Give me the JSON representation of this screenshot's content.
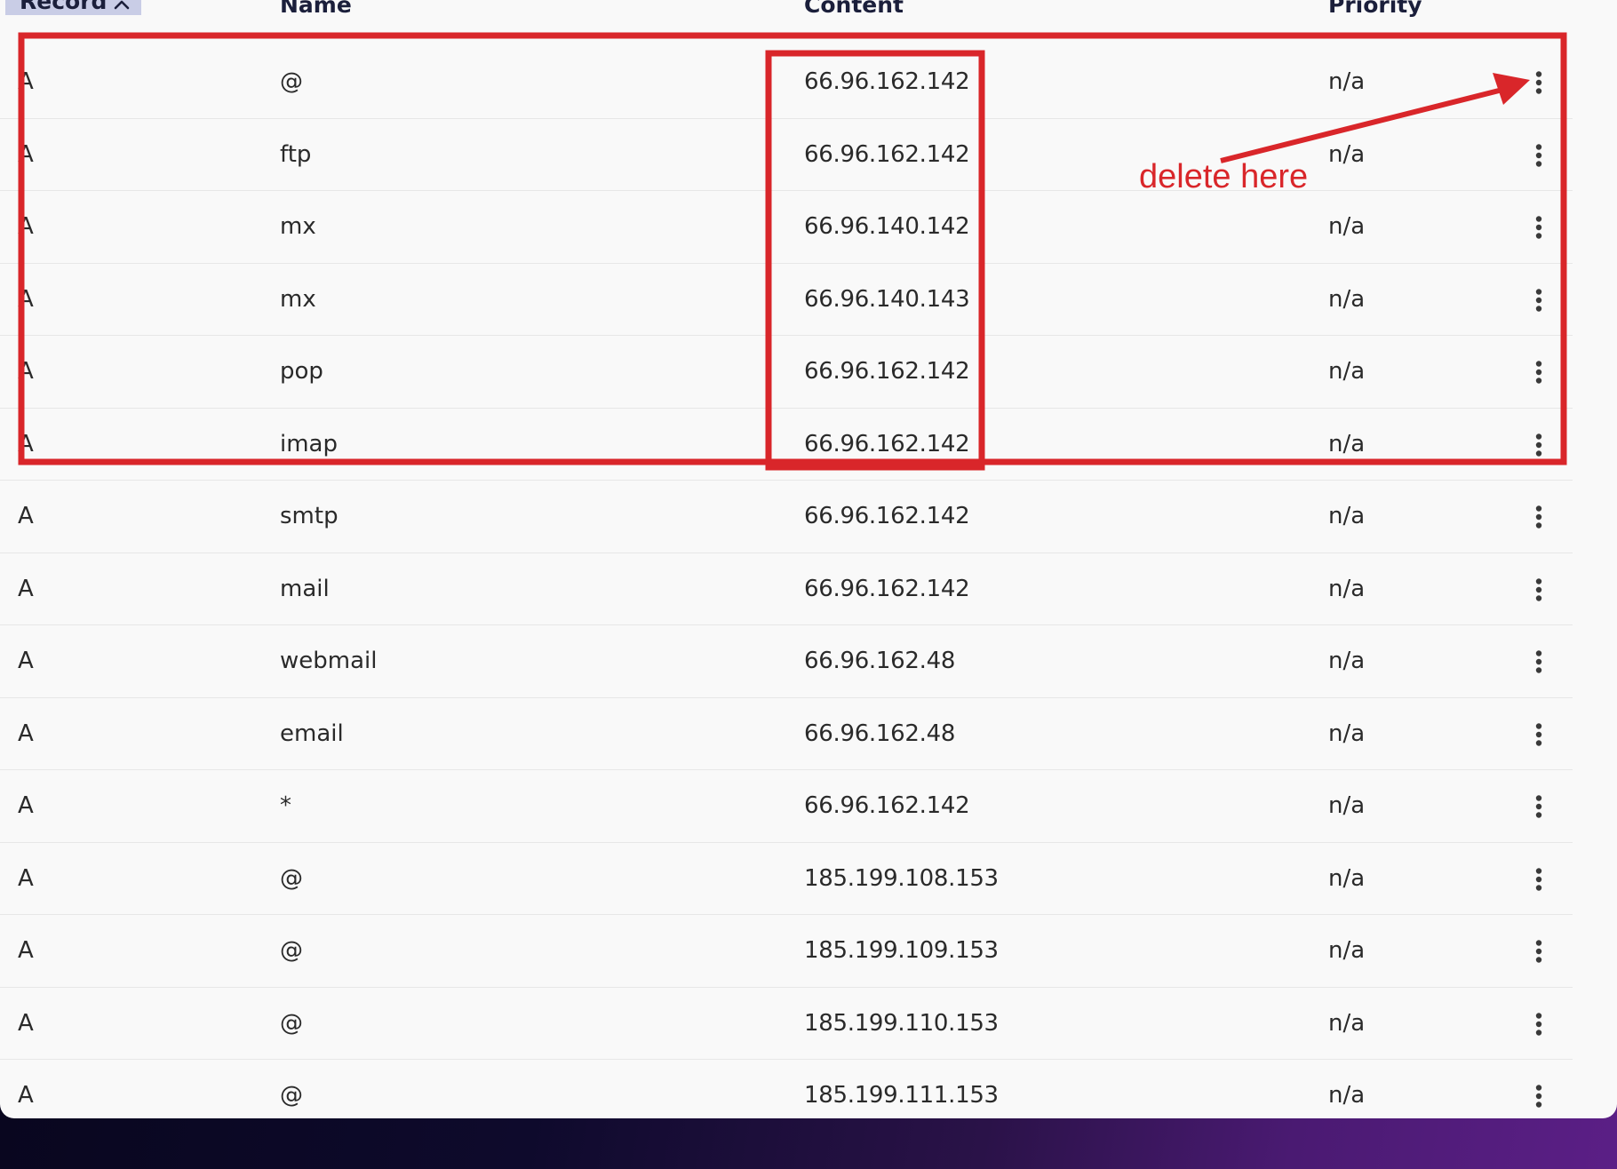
{
  "table": {
    "headers": {
      "record": "Record",
      "name": "Name",
      "content": "Content",
      "priority": "Priority"
    },
    "sort": {
      "column": "record",
      "direction": "ascending",
      "icon": "chevron-up-icon"
    },
    "rows": [
      {
        "record": "A",
        "name": "@",
        "content": "66.96.162.142",
        "priority": "n/a"
      },
      {
        "record": "A",
        "name": "ftp",
        "content": "66.96.162.142",
        "priority": "n/a"
      },
      {
        "record": "A",
        "name": "mx",
        "content": "66.96.140.142",
        "priority": "n/a"
      },
      {
        "record": "A",
        "name": "mx",
        "content": "66.96.140.143",
        "priority": "n/a"
      },
      {
        "record": "A",
        "name": "pop",
        "content": "66.96.162.142",
        "priority": "n/a"
      },
      {
        "record": "A",
        "name": "imap",
        "content": "66.96.162.142",
        "priority": "n/a"
      },
      {
        "record": "A",
        "name": "smtp",
        "content": "66.96.162.142",
        "priority": "n/a"
      },
      {
        "record": "A",
        "name": "mail",
        "content": "66.96.162.142",
        "priority": "n/a"
      },
      {
        "record": "A",
        "name": "webmail",
        "content": "66.96.162.48",
        "priority": "n/a"
      },
      {
        "record": "A",
        "name": "email",
        "content": "66.96.162.48",
        "priority": "n/a"
      },
      {
        "record": "A",
        "name": "*",
        "content": "66.96.162.142",
        "priority": "n/a"
      },
      {
        "record": "A",
        "name": "@",
        "content": "185.199.108.153",
        "priority": "n/a"
      },
      {
        "record": "A",
        "name": "@",
        "content": "185.199.109.153",
        "priority": "n/a"
      },
      {
        "record": "A",
        "name": "@",
        "content": "185.199.110.153",
        "priority": "n/a"
      },
      {
        "record": "A",
        "name": "@",
        "content": "185.199.111.153",
        "priority": "n/a"
      }
    ],
    "row_action_icon": "more-vertical-icon"
  },
  "annotation": {
    "text": "delete here",
    "color": "#d9262a"
  },
  "colors": {
    "panel_background": "#f9f9f9",
    "header_text": "#1b1f3b",
    "sorted_header_highlight": "#c9cde6",
    "cell_text": "#2a2a2a",
    "row_divider": "#e7e7e7"
  }
}
